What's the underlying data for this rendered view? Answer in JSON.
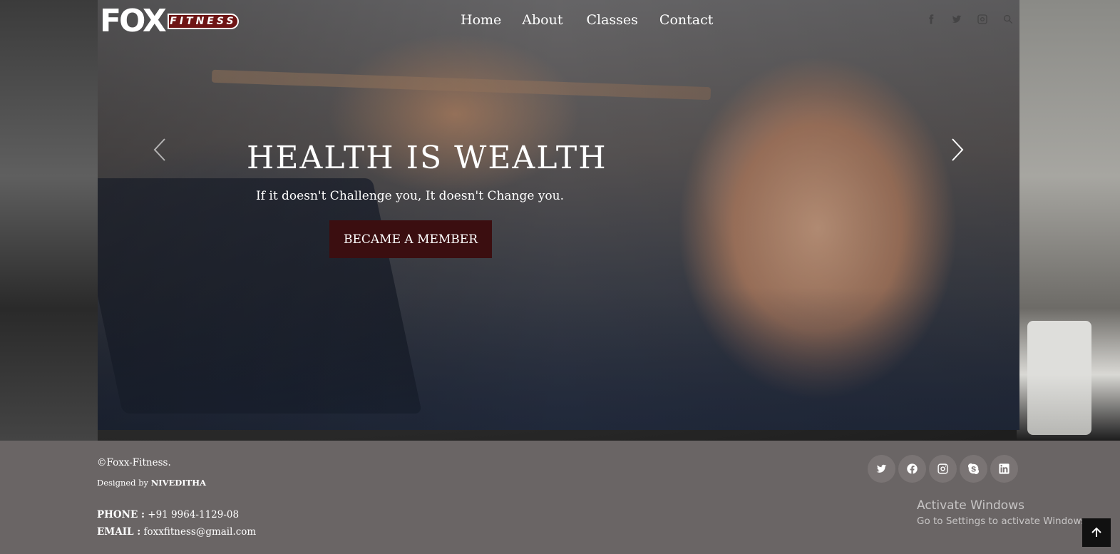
{
  "brand": {
    "mark": "FOX",
    "word": "FITNESS"
  },
  "nav": {
    "items": [
      "Home",
      "About",
      "Classes",
      "Contact"
    ]
  },
  "header_icons": [
    "facebook-icon",
    "twitter-icon",
    "instagram-icon",
    "search-icon"
  ],
  "hero": {
    "title": "HEALTH IS WEALTH",
    "subtitle": "If it doesn't Challenge you, It doesn't Change you.",
    "cta_label": "BECAME A MEMBER"
  },
  "footer": {
    "copyright": "©Foxx-Fitness.",
    "designed_prefix": "Designed by ",
    "designed_name": "NIVEDITHA",
    "phone_label": "PHONE :",
    "phone_value": " +91 9964-1129-08",
    "email_label": "EMAIL :",
    "email_value": " foxxfitness@gmail.com",
    "socials": [
      "twitter-icon",
      "facebook-icon",
      "instagram-icon",
      "skype-icon",
      "linkedin-icon"
    ]
  },
  "watermark": {
    "title": "Activate Windows",
    "subtitle": "Go to Settings to activate Windows."
  },
  "colors": {
    "cta_bg": "#3b0e10",
    "footer_bg": "#6a6565",
    "brand_red": "#6e1515"
  }
}
